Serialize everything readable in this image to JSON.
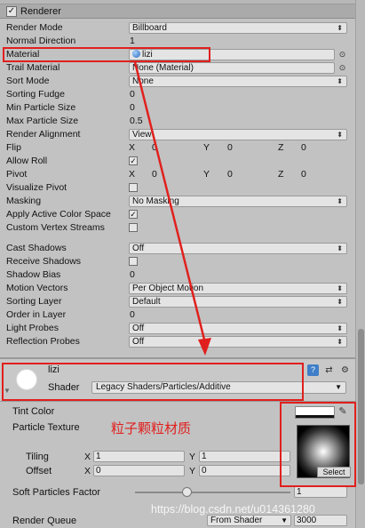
{
  "renderer": {
    "header_title": "Renderer",
    "enabled_check": "✓",
    "rows": [
      {
        "label": "Render Mode",
        "kind": "dropdown",
        "value": "Billboard"
      },
      {
        "label": "Normal Direction",
        "kind": "text",
        "value": "1"
      },
      {
        "label": "Material",
        "kind": "object",
        "value": "lizi"
      },
      {
        "label": "Trail Material",
        "kind": "object",
        "value": "None (Material)"
      },
      {
        "label": "Sort Mode",
        "kind": "dropdown",
        "value": "None"
      },
      {
        "label": "Sorting Fudge",
        "kind": "text",
        "value": "0"
      },
      {
        "label": "Min Particle Size",
        "kind": "text",
        "value": "0"
      },
      {
        "label": "Max Particle Size",
        "kind": "text",
        "value": "0.5"
      },
      {
        "label": "Render Alignment",
        "kind": "dropdown",
        "value": "View"
      },
      {
        "label": "Flip",
        "kind": "vector3",
        "x": "0",
        "y": "0",
        "z": "0"
      },
      {
        "label": "Allow Roll",
        "kind": "checkbox",
        "checked": true
      },
      {
        "label": "Pivot",
        "kind": "vector3",
        "x": "0",
        "y": "0",
        "z": "0"
      },
      {
        "label": "Visualize Pivot",
        "kind": "checkbox",
        "checked": false
      },
      {
        "label": "Masking",
        "kind": "dropdown",
        "value": "No Masking"
      },
      {
        "label": "Apply Active Color Space",
        "kind": "checkbox",
        "checked": true
      },
      {
        "label": "Custom Vertex Streams",
        "kind": "checkbox",
        "checked": false
      },
      {
        "label": "Cast Shadows",
        "kind": "dropdown",
        "value": "Off"
      },
      {
        "label": "Receive Shadows",
        "kind": "checkbox",
        "checked": false
      },
      {
        "label": "Shadow Bias",
        "kind": "text",
        "value": "0"
      },
      {
        "label": "Motion Vectors",
        "kind": "dropdown",
        "value": "Per Object Motion"
      },
      {
        "label": "Sorting Layer",
        "kind": "dropdown",
        "value": "Default"
      },
      {
        "label": "Order in Layer",
        "kind": "text",
        "value": "0"
      },
      {
        "label": "Light Probes",
        "kind": "dropdown",
        "value": "Off"
      },
      {
        "label": "Reflection Probes",
        "kind": "dropdown",
        "value": "Off"
      }
    ],
    "axis_x": "X",
    "axis_y": "Y",
    "axis_z": "Z"
  },
  "material": {
    "name": "lizi",
    "shader_label": "Shader",
    "shader_value": "Legacy Shaders/Particles/Additive",
    "tint_color_label": "Tint Color",
    "tint_color": "#ffffff",
    "particle_texture_label": "Particle Texture",
    "texture_select_label": "Select",
    "tiling_label": "Tiling",
    "tiling_x": "1",
    "tiling_y": "1",
    "offset_label": "Offset",
    "offset_x": "0",
    "offset_y": "0",
    "soft_particles_label": "Soft Particles Factor",
    "soft_particles_value": "1",
    "render_queue_label": "Render Queue",
    "render_queue_mode": "From Shader",
    "render_queue_value": "3000",
    "axis_x": "X",
    "axis_y": "Y"
  },
  "annotation_text": "粒子颗粒材质",
  "watermark": "https://blog.csdn.net/u014361280",
  "colors": {
    "annotation_red": "#e0201e",
    "material_icon": "#2767b8"
  }
}
